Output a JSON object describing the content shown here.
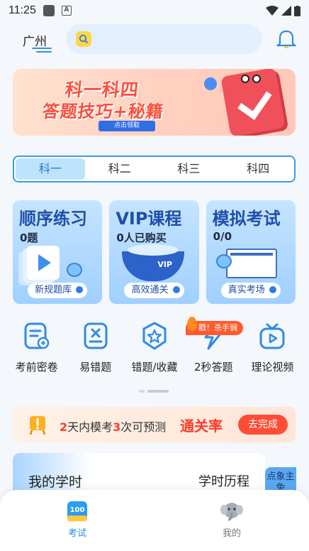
{
  "status_bar": {
    "time": "11:25"
  },
  "header": {
    "city": "广州",
    "search_placeholder": ""
  },
  "banner": {
    "line1": "科一科四",
    "line2": "答题技巧+秘籍",
    "cta": "点击领取"
  },
  "subject_tabs": [
    {
      "label": "科一",
      "active": true
    },
    {
      "label": "科二",
      "active": false
    },
    {
      "label": "科三",
      "active": false
    },
    {
      "label": "科四",
      "active": false
    }
  ],
  "feature_cards": [
    {
      "title": "顺序练习",
      "stat": "0题",
      "button": "新规题库"
    },
    {
      "title": "VIP课程",
      "stat": "0人已购买",
      "button": "高效通关"
    },
    {
      "title": "模拟考试",
      "stat": "0/0",
      "button": "真实考场"
    }
  ],
  "quick_icons": [
    {
      "label": "考前密卷",
      "icon": "exam-paper-icon"
    },
    {
      "label": "易错题",
      "icon": "wrong-question-icon"
    },
    {
      "label": "错题/收藏",
      "icon": "favorite-star-icon"
    },
    {
      "label": "2秒答题",
      "icon": "lightning-icon"
    },
    {
      "label": "理论视频",
      "icon": "video-tv-icon"
    }
  ],
  "hot_badge": "戳！杀手锏",
  "promo": {
    "num1": "2",
    "part1": "天内模考",
    "num2": "3",
    "part2": "次可预测",
    "highlight": "通关率",
    "button": "去完成"
  },
  "study": {
    "title": "我的学时",
    "history": "学时历程",
    "side_tag": "点象主免"
  },
  "bottom_tabs": [
    {
      "label": "考试",
      "icon": "exam-100-icon",
      "active": true
    },
    {
      "label": "我的",
      "icon": "elephant-avatar-icon",
      "active": false
    }
  ],
  "colors": {
    "accent": "#1f8ef0",
    "promo_red": "#ff3b2a",
    "card_blue": "#9fd0ff"
  }
}
